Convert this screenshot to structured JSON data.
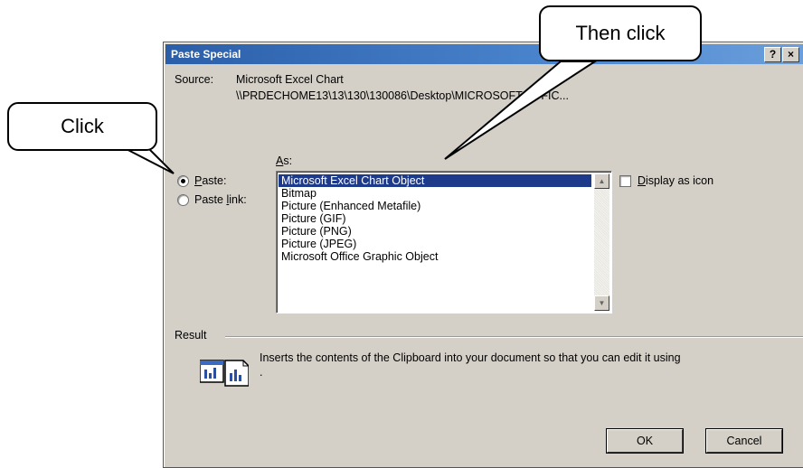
{
  "dialog": {
    "title": "Paste Special",
    "help_button": "?",
    "close_button": "×",
    "source_label": "Source:",
    "source_name": "Microsoft Excel Chart",
    "source_path": "\\\\PRDECHOME13\\13\\130\\130086\\Desktop\\MICROSOFT OFFIC...",
    "as_label": "As:",
    "paste_label": "Paste:",
    "paste_link_label": "Paste link:",
    "paste_selected": true,
    "list_items": [
      "Microsoft Excel Chart Object",
      "Bitmap",
      "Picture (Enhanced Metafile)",
      "Picture (GIF)",
      "Picture (PNG)",
      "Picture (JPEG)",
      "Microsoft Office Graphic Object"
    ],
    "selected_item": "Microsoft Excel Chart Object",
    "display_as_icon_label": "Display as icon",
    "display_as_icon_checked": false,
    "result_label": "Result",
    "result_text": "Inserts the contents of the Clipboard into your document so that you can edit it using",
    "result_text_line2": ".",
    "ok_label": "OK",
    "cancel_label": "Cancel"
  },
  "callouts": {
    "click": "Click",
    "then_click": "Then click"
  },
  "colors": {
    "title_bar": "#2b5ea8",
    "dialog_bg": "#d4d0c8",
    "selection": "#1e3a8a"
  }
}
